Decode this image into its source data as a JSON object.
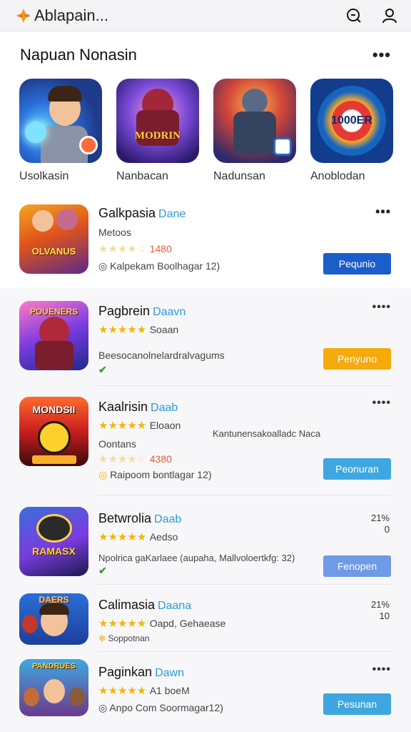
{
  "header": {
    "title": "Ablapain...",
    "icons": [
      "chat-search-icon",
      "user-icon"
    ]
  },
  "featured_section": {
    "title": "Napuan Nonasin",
    "more": "•••",
    "items": [
      {
        "label": "Usolkasin",
        "art_text": ""
      },
      {
        "label": "Nanbacan",
        "art_text": "MODRIN"
      },
      {
        "label": "Nadunsan",
        "art_text": ""
      },
      {
        "label": "Anoblodan",
        "art_text": "1000ER"
      }
    ]
  },
  "list": [
    {
      "title": "Galkpasia",
      "tag": "Dane",
      "subtitle": "Metoos",
      "stars": "★★★★☆",
      "rating": "1480",
      "meta": "Kalpekam  Boolhagar 12)",
      "button": "Pequnio",
      "button_color": "#1b5ec9",
      "more": "•••",
      "art_text": "OLVANUS"
    },
    {
      "title": "Pagbrein",
      "tag": "Daavn",
      "stars": "★★★★★",
      "rating_label": "Soaan",
      "desc": "Beesocanolnelardralvagums",
      "button": "Penyuno",
      "button_color": "#f6aa0c",
      "more": "••••",
      "art_text": "POUENERS"
    },
    {
      "title": "Kaalrisin",
      "tag": "Daab",
      "stars": "★★★★★",
      "rating_label": "Eloaon",
      "desc": "Kantunensakoalladc Naca",
      "subtitle": "Oontans",
      "stars2": "★★★★☆",
      "rating": "4380",
      "meta": "Raipoom  bontlagar 12)",
      "button": "Peonuran",
      "button_color": "#3fa7e0",
      "more": "••••",
      "art_text": "MONDSII"
    },
    {
      "title": "Betwrolia",
      "tag": "Daab",
      "stars": "★★★★★",
      "rating_label": "Aedso",
      "desc": "Npolrica gaKarlaee (aupaha, Mallvoloertkfg: 32)",
      "button": "Fenopen",
      "button_color": "#6f9ae8",
      "percent": "21%",
      "percent_sub": "0",
      "art_text": "RAMASX"
    },
    {
      "title": "Calimasia",
      "tag": "Daana",
      "stars": "★★★★★",
      "rating_label": "Oapd,  Gehaease",
      "meta": "Soppotnan",
      "percent": "21%",
      "percent_sub": "10",
      "art_text": "DAERS"
    },
    {
      "title": "Paginkan",
      "tag": "Dawn",
      "stars": "★★★★★",
      "rating_label": "A1 boeM",
      "meta": "Anpo Com  Soormagar12)",
      "button": "Pesunan",
      "button_color": "#3fa7e0",
      "more": "••••",
      "art_text": "PANDRUES"
    }
  ]
}
